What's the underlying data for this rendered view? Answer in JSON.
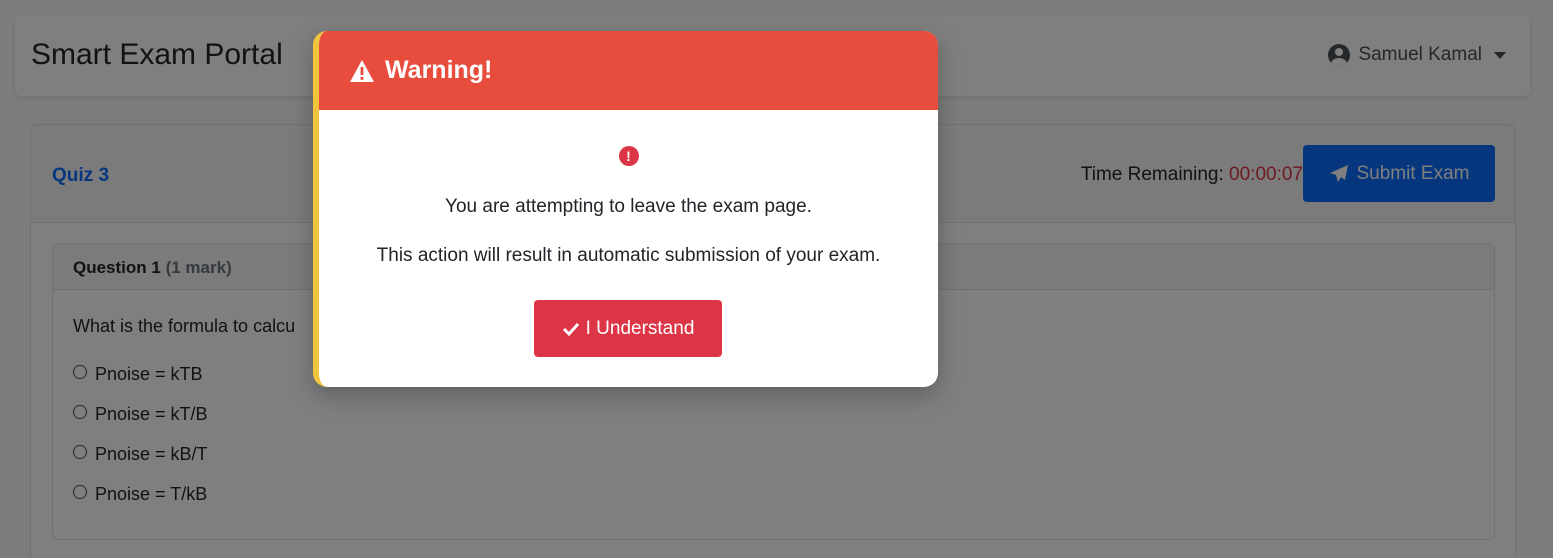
{
  "navbar": {
    "brand": "Smart Exam Portal",
    "user_name": "Samuel Kamal",
    "user_icon": "user-circle-icon",
    "dropdown_icon": "caret-down-icon"
  },
  "exam": {
    "quiz_title": "Quiz 3",
    "time_label": "Time Remaining:",
    "time_value": "00:00:07",
    "submit_label": "Submit Exam",
    "submit_icon": "paper-plane-icon"
  },
  "question": {
    "number": "Question 1",
    "marks": "(1 mark)",
    "text": "What is the formula to calcu",
    "options": [
      "Pnoise = kTB",
      "Pnoise = kT/B",
      "Pnoise = kB/T",
      "Pnoise = T/kB"
    ]
  },
  "modal": {
    "title": "Warning!",
    "title_icon": "warning-triangle-icon",
    "alert_icon": "exclamation-circle-icon",
    "alert_glyph": "!",
    "message_1": "You are attempting to leave the exam page.",
    "message_2": "This action will result in automatic submission of your exam.",
    "button_label": "I Understand",
    "button_icon": "check-icon"
  },
  "colors": {
    "modal_header": "#e74c3c",
    "modal_accent_border": "#f0c43c",
    "danger": "#dc3545",
    "primary": "#0d6efd"
  }
}
